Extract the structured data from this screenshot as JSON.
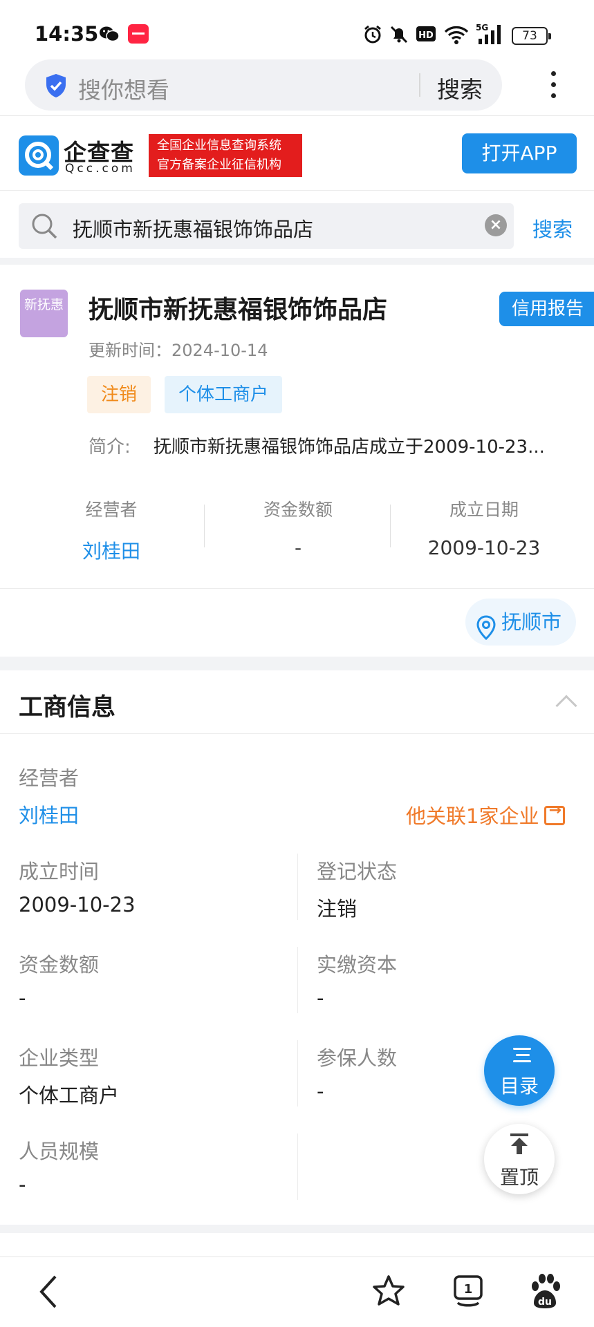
{
  "status_bar": {
    "time": "14:35",
    "battery": "73",
    "icons": [
      "wechat-icon",
      "xiaohongshu-icon",
      "alarm-icon",
      "mute-icon",
      "hd-icon",
      "wifi-icon",
      "5g-signal-icon"
    ]
  },
  "browser": {
    "search_placeholder": "搜你想看",
    "search_button": "搜索"
  },
  "site": {
    "logo_text": "企查查",
    "logo_sub": "Qcc.com",
    "badge_line1": "全国企业信息查询系统",
    "badge_line2": "官方备案企业征信机构",
    "open_app": "打开APP",
    "search_value": "抚顺市新抚惠福银饰饰品店",
    "search_button": "搜索"
  },
  "company": {
    "avatar_text": "新抚惠",
    "name": "抚顺市新抚惠福银饰饰品店",
    "credit_report": "信用报告",
    "updated": "更新时间：2024-10-14",
    "tags": [
      "注销",
      "个体工商户"
    ],
    "intro_label": "简介:",
    "intro": "抚顺市新抚惠福银饰饰品店成立于2009-10-23...",
    "stats": [
      {
        "label": "经营者",
        "value": "刘桂田"
      },
      {
        "label": "资金数额",
        "value": "-"
      },
      {
        "label": "成立日期",
        "value": "2009-10-23"
      }
    ],
    "location": "抚顺市"
  },
  "business_info": {
    "title": "工商信息",
    "operator_label": "经营者",
    "operator": "刘桂田",
    "related": "他关联1家企业",
    "fields": [
      {
        "label": "成立时间",
        "value": "2009-10-23"
      },
      {
        "label": "登记状态",
        "value": "注销"
      },
      {
        "label": "资金数额",
        "value": "-"
      },
      {
        "label": "实缴资本",
        "value": "-"
      },
      {
        "label": "企业类型",
        "value": "个体工商户"
      },
      {
        "label": "参保人数",
        "value": "-"
      },
      {
        "label": "人员规模",
        "value": "-"
      }
    ]
  },
  "floating": {
    "toc": "目录",
    "top": "置顶"
  },
  "bottom_nav": {
    "tab_count": "1"
  },
  "colors": {
    "accent": "#1e8fe8",
    "cancel_tag": "#f08a1a",
    "related_link": "#f07a2a",
    "badge_red": "#e31d1d"
  }
}
